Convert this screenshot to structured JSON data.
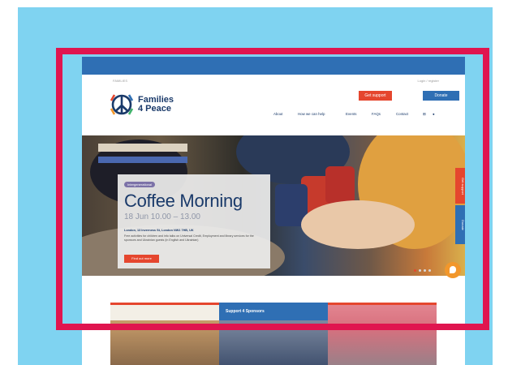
{
  "site": {
    "utility_left": "FAMILIES",
    "utility_right": "Login / register",
    "logo_line1": "Families",
    "logo_line2": "4 Peace"
  },
  "header": {
    "support_button": "Get support",
    "donate_button": "Donate"
  },
  "nav": {
    "items": [
      "About",
      "How we can help",
      "Events",
      "FAQs",
      "Contact"
    ]
  },
  "hero": {
    "badge": "Intergenerational",
    "title": "Coffee Morning",
    "time": "18 Jun 10.00 – 13.00",
    "location": "London, 13 Inverness St, London NW1 7HB, UK",
    "description": "Free activities for children and info talks on Universal Credit, Employment and library services for the sponsors and Ukrainian guests (in English and Ukrainian)",
    "button": "Find out more",
    "slide_count": 4,
    "active_slide": 1
  },
  "side_tabs": {
    "support": "Get support",
    "donate": "Donate"
  },
  "tiles": {
    "middle_label": "Support 4 Sponsors"
  },
  "colors": {
    "sky": "#7fd3f1",
    "frame": "#e0154f",
    "blue": "#2f6fb4",
    "red": "#e5462e",
    "navy": "#1a3a6a",
    "orange": "#f2972b"
  }
}
